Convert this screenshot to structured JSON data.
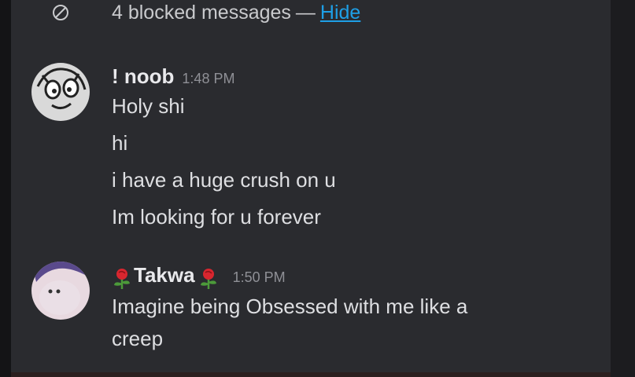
{
  "blocked": {
    "text": "4 blocked messages",
    "separator": "—",
    "link": "Hide"
  },
  "messages": [
    {
      "username": "! noob",
      "time": "1:48 PM",
      "lines": [
        "Holy shi",
        "hi",
        "i have a huge crush on u",
        "Im looking for u forever"
      ]
    },
    {
      "username": "Takwa",
      "time": "1:50 PM",
      "lines": [
        "Imagine being Obsessed with me like a",
        "creep"
      ]
    }
  ],
  "colors": {
    "background": "#2a2b2f",
    "link": "#1e9fe6",
    "text": "#dedfe2",
    "muted": "#8f9096"
  },
  "icons": {
    "blocked": "blocked-circle-icon",
    "rose": "rose-icon"
  }
}
